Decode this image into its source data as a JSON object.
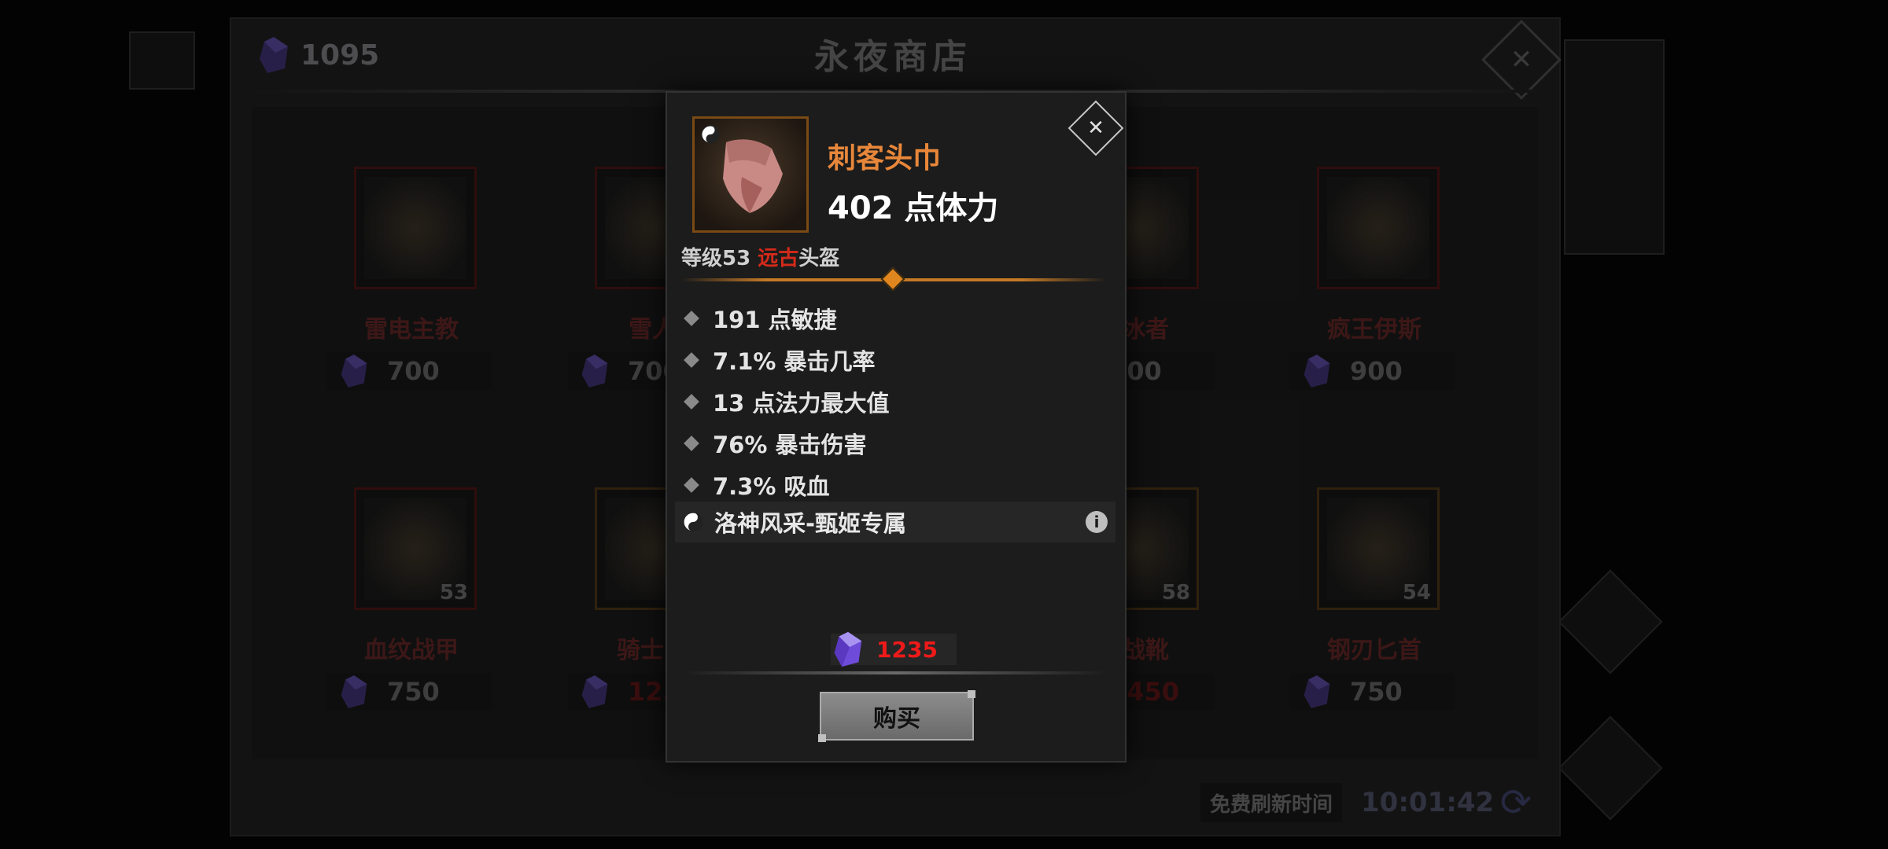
{
  "shop": {
    "title": "永夜商店",
    "currency_amount": "1095",
    "items": [
      {
        "name": "雷电主教",
        "price": "700",
        "level": ""
      },
      {
        "name": "雪人",
        "price": "700",
        "level": ""
      },
      {
        "name": "喷冰者",
        "price": "700",
        "level": ""
      },
      {
        "name": "疯王伊斯",
        "price": "900",
        "level": ""
      },
      {
        "name": "血纹战甲",
        "price": "750",
        "level": "53"
      },
      {
        "name": "骑士战",
        "price": "125",
        "level": ""
      },
      {
        "name": "铁战靴",
        "price": "1450",
        "level": "58"
      },
      {
        "name": "钢刃匕首",
        "price": "750",
        "level": "54"
      }
    ],
    "refresh_label": "免费刷新时间",
    "refresh_timer": "10:01:42"
  },
  "modal": {
    "item_name": "刺客头巾",
    "main_stat": "402 点体力",
    "level_label": "等级53",
    "rarity": "远古",
    "slot": "头盔",
    "stats": [
      "191 点敏捷",
      "7.1% 暴击几率",
      "13 点法力最大值",
      "76% 暴击伤害",
      "7.3% 吸血"
    ],
    "set_bonus": "洛神风采-甄姬专属",
    "price": "1235",
    "buy_label": "购买"
  },
  "colors": {
    "item_name": "#e8873a",
    "rarity_ancient": "#d42a1a",
    "price_insufficient": "#ee1a1a",
    "gem": "#6e4bd8"
  }
}
